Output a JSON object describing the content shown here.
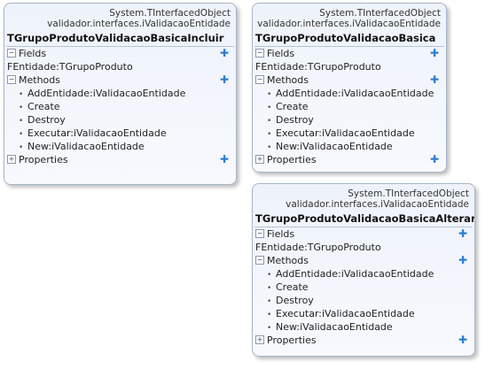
{
  "classes": [
    {
      "stereotype_line1": "System.TInterfacedObject",
      "stereotype_line2": "validador.interfaces.iValidacaoEntidade",
      "title": "TGrupoProdutoValidacaoBasicaIncluir",
      "sections": {
        "fields": {
          "label": "Fields",
          "toggle": "−",
          "items": [
            "FEntidade:TGrupoProduto"
          ]
        },
        "methods": {
          "label": "Methods",
          "toggle": "−",
          "items": [
            "AddEntidade:iValidacaoEntidade",
            "Create",
            "Destroy",
            "Executar:iValidacaoEntidade",
            "New:iValidacaoEntidade"
          ]
        },
        "properties": {
          "label": "Properties",
          "toggle": "+"
        }
      }
    },
    {
      "stereotype_line1": "System.TInterfacedObject",
      "stereotype_line2": "validador.interfaces.iValidacaoEntidade",
      "title": "TGrupoProdutoValidacaoBasica",
      "sections": {
        "fields": {
          "label": "Fields",
          "toggle": "−",
          "items": [
            "FEntidade:TGrupoProduto"
          ]
        },
        "methods": {
          "label": "Methods",
          "toggle": "−",
          "items": [
            "AddEntidade:iValidacaoEntidade",
            "Create",
            "Destroy",
            "Executar:iValidacaoEntidade",
            "New:iValidacaoEntidade"
          ]
        },
        "properties": {
          "label": "Properties",
          "toggle": "+"
        }
      }
    },
    {
      "stereotype_line1": "System.TInterfacedObject",
      "stereotype_line2": "validador.interfaces.iValidacaoEntidade",
      "title": "TGrupoProdutoValidacaoBasicaAlterar",
      "sections": {
        "fields": {
          "label": "Fields",
          "toggle": "−",
          "items": [
            "FEntidade:TGrupoProduto"
          ]
        },
        "methods": {
          "label": "Methods",
          "toggle": "−",
          "items": [
            "AddEntidade:iValidacaoEntidade",
            "Create",
            "Destroy",
            "Executar:iValidacaoEntidade",
            "New:iValidacaoEntidade"
          ]
        },
        "properties": {
          "label": "Properties",
          "toggle": "+"
        }
      }
    }
  ],
  "icons": {
    "section_add": "plus-icon",
    "bullet": "bullet-icon",
    "collapse": "minus-toggle-icon",
    "expand": "plus-toggle-icon"
  },
  "colors": {
    "border": "#a8b4c8",
    "background": "#eef3fb",
    "add_icon": "#2f7fcf"
  }
}
